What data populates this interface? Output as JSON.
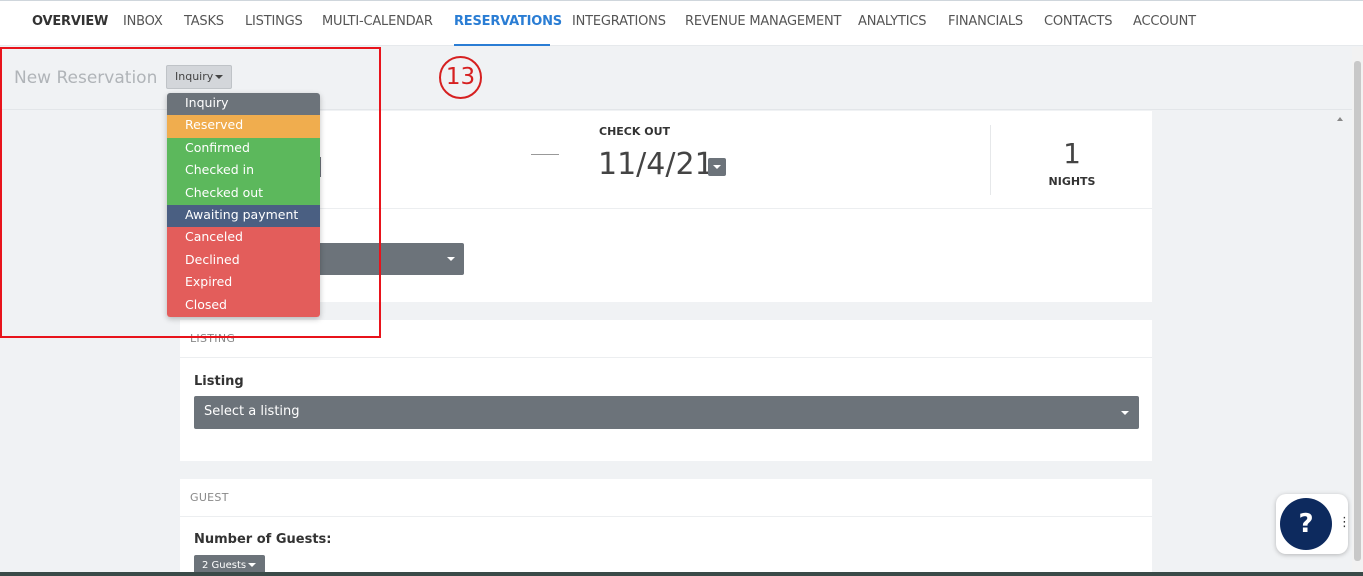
{
  "nav": {
    "items": [
      "OVERVIEW",
      "INBOX",
      "TASKS",
      "LISTINGS",
      "MULTI-CALENDAR",
      "RESERVATIONS",
      "INTEGRATIONS",
      "REVENUE MANAGEMENT",
      "ANALYTICS",
      "FINANCIALS",
      "CONTACTS",
      "ACCOUNT"
    ],
    "active": "RESERVATIONS",
    "active_color": "#2a7dd4"
  },
  "header": {
    "title": "New Reservation",
    "status_value": "Inquiry",
    "step_badge": "13"
  },
  "status_menu": [
    {
      "label": "Inquiry",
      "color": "#6c737a"
    },
    {
      "label": "Reserved",
      "color": "#f0ad4e"
    },
    {
      "label": "Confirmed",
      "color": "#5cb85c"
    },
    {
      "label": "Checked in",
      "color": "#5cb85c"
    },
    {
      "label": "Checked out",
      "color": "#5cb85c"
    },
    {
      "label": "Awaiting payment",
      "color": "#4a5f82"
    },
    {
      "label": "Canceled",
      "color": "#e35d5b"
    },
    {
      "label": "Declined",
      "color": "#e35d5b"
    },
    {
      "label": "Expired",
      "color": "#e35d5b"
    },
    {
      "label": "Closed",
      "color": "#e35d5b"
    }
  ],
  "dates": {
    "checkout_label": "CHECK OUT",
    "checkout_value": "11/4/21",
    "nights_value": "1",
    "nights_label": "NIGHTS"
  },
  "listing_section": {
    "section_label": "LISTING",
    "field_label": "Listing",
    "select_value": "Select a listing"
  },
  "guest_section": {
    "section_label": "GUEST",
    "field_label": "Number of Guests:",
    "guests_value": "2 Guests"
  },
  "help": {
    "label": "?"
  },
  "colors": {
    "highlight": "#e8131b",
    "help_button": "#0d2a5e",
    "select_gray": "#6c737a"
  }
}
